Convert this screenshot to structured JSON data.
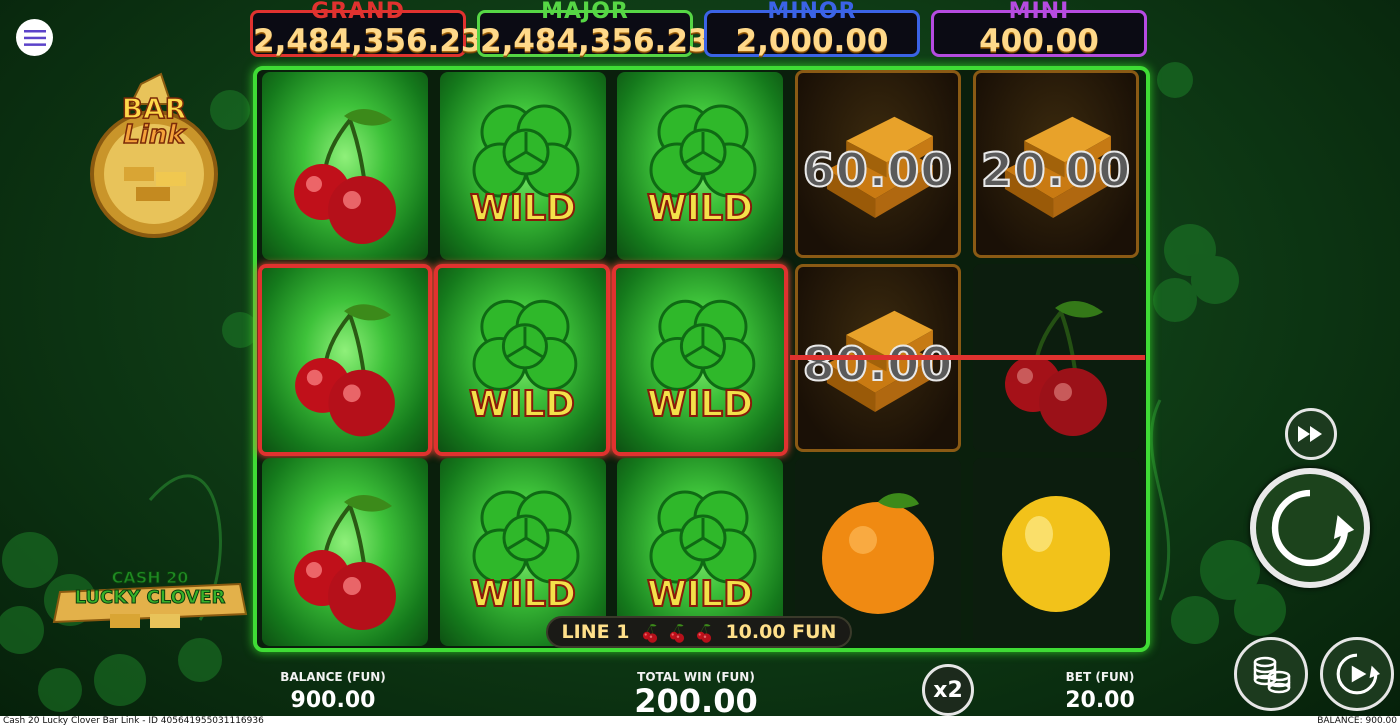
{
  "menu": {
    "icon": "hamburger-menu-icon"
  },
  "jackpots": [
    {
      "name": "GRAND",
      "value": "2,484,356.23",
      "color": "#e0322f"
    },
    {
      "name": "MAJOR",
      "value": "2,484,356.23",
      "color": "#56d645"
    },
    {
      "name": "MINOR",
      "value": "2,000.00",
      "color": "#3b63e6"
    },
    {
      "name": "MINI",
      "value": "400.00",
      "color": "#b64be0"
    }
  ],
  "logos": {
    "bar_link": {
      "line1": "BAR",
      "line2": "Link"
    },
    "cash_lucky": {
      "line1": "CASH 20",
      "line2": "LUCKY CLOVER"
    }
  },
  "reels": {
    "wild_label": "WILD",
    "gold_values": {
      "r4_row1": "60.00",
      "r5_row1": "20.00",
      "r4_row2": "80.00"
    },
    "grid": [
      [
        "cherry",
        "wild",
        "wild",
        "gold",
        "gold"
      ],
      [
        "cherry",
        "wild",
        "wild",
        "gold",
        "cherry"
      ],
      [
        "cherry",
        "wild",
        "wild",
        "orange",
        "lemon"
      ]
    ],
    "winning_positions": "row 2, reels 1-3"
  },
  "win_banner": {
    "line": "LINE 1",
    "amount": "10.00 FUN",
    "symbol": "cherry-icon"
  },
  "stats": {
    "balance_label": "BALANCE (FUN)",
    "balance_value": "900.00",
    "total_win_label": "TOTAL WIN (FUN)",
    "total_win_value": "200.00",
    "bet_label": "BET (FUN)",
    "bet_value": "20.00"
  },
  "buttons": {
    "x2": "x2",
    "fast_forward": "fast-forward-icon",
    "spin": "spin-icon",
    "coins": "coin-stack-icon",
    "autoplay": "autoplay-icon"
  },
  "footer": {
    "left": "Cash 20 Lucky Clover Bar Link - ID 405641955031116936",
    "right": "BALANCE: 900.00"
  },
  "colors": {
    "reel_border": "#3fdc35",
    "win_highlight": "#e0322f",
    "background": "#0f3d16"
  }
}
